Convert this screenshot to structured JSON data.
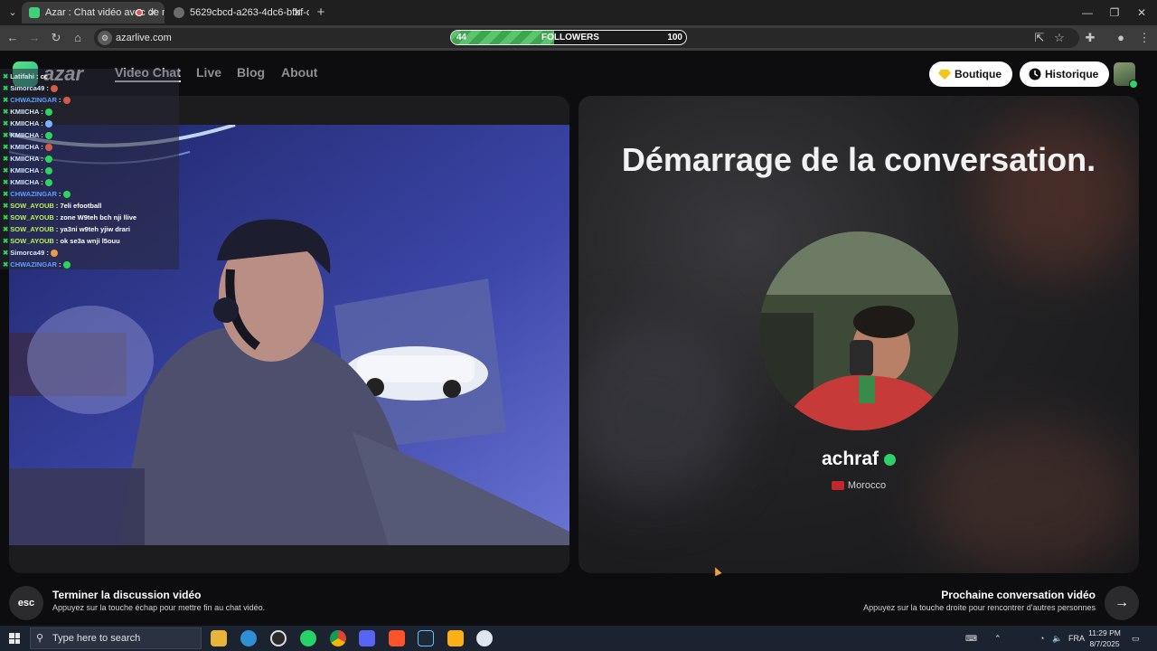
{
  "browser": {
    "tabs": [
      {
        "title": "Azar : Chat vidéo avec de n",
        "active": true
      },
      {
        "title": "5629cbcd-a263-4dc6-bfbf-c65",
        "active": false
      }
    ],
    "url": "azarlive.com",
    "followers_overlay": {
      "label": "FOLLOWERS",
      "current": "44",
      "goal": "100",
      "progress": 0.44
    }
  },
  "header": {
    "logo_text": "azar",
    "nav": [
      {
        "label": "Video Chat",
        "active": true
      },
      {
        "label": "Live",
        "active": false
      },
      {
        "label": "Blog",
        "active": false
      },
      {
        "label": "About",
        "active": false
      }
    ],
    "boutique_label": "Boutique",
    "historique_label": "Historique"
  },
  "chat": [
    {
      "user": "Latifahi",
      "msg": "cc",
      "color": "u"
    },
    {
      "user": "Simorca49",
      "msg": "",
      "emote": "#d45a4a",
      "color": "u"
    },
    {
      "user": "CHWAZINGAR",
      "msg": "",
      "emote": "#d45a4a",
      "color": "b"
    },
    {
      "user": "KMIICHA",
      "msg": "",
      "emote": "#2dd35a",
      "color": "u"
    },
    {
      "user": "KMIICHA",
      "msg": "",
      "emote": "#7ab4ff",
      "color": "u"
    },
    {
      "user": "KMIICHA",
      "msg": "",
      "emote": "#2dd35a",
      "color": "u"
    },
    {
      "user": "KMIICHA",
      "msg": "",
      "emote": "#d45a4a",
      "color": "u"
    },
    {
      "user": "KMIICHA",
      "msg": "",
      "emote": "#2dd35a",
      "color": "u"
    },
    {
      "user": "KMIICHA",
      "msg": "",
      "emote": "#2dd35a",
      "color": "u"
    },
    {
      "user": "KMIICHA",
      "msg": "",
      "emote": "#2dd35a",
      "color": "u"
    },
    {
      "user": "CHWAZINGAR",
      "msg": "",
      "emote": "#2dd35a",
      "color": "b"
    },
    {
      "user": "SOW_AYOUB",
      "msg": "7eli efootball",
      "color": "g"
    },
    {
      "user": "SOW_AYOUB",
      "msg": "zone W9teh bch nji llive",
      "color": "g"
    },
    {
      "user": "SOW_AYOUB",
      "msg": "ya3ni w9teh yjiw drari",
      "color": "g"
    },
    {
      "user": "SOW_AYOUB",
      "msg": "ok se3a wnji l5ouu",
      "color": "g"
    },
    {
      "user": "Simorca49",
      "msg": "",
      "emote": "#e89a4a",
      "color": "u"
    },
    {
      "user": "CHWAZINGAR",
      "msg": "",
      "emote": "#2dd35a",
      "color": "b"
    }
  ],
  "right_panel": {
    "title": "Démarrage de la conversation.",
    "username": "achraf",
    "country": "Morocco"
  },
  "bottom": {
    "esc_label": "esc",
    "end_title": "Terminer la discussion vidéo",
    "end_sub": "Appuyez sur la touche échap pour mettre fin au chat vidéo.",
    "next_title": "Prochaine conversation vidéo",
    "next_sub": "Appuyez sur la touche droite pour rencontrer d'autres personnes"
  },
  "taskbar": {
    "search_placeholder": "Type here to search",
    "language": "FRA",
    "time": "11:29 PM",
    "date": "8/7/2025"
  }
}
